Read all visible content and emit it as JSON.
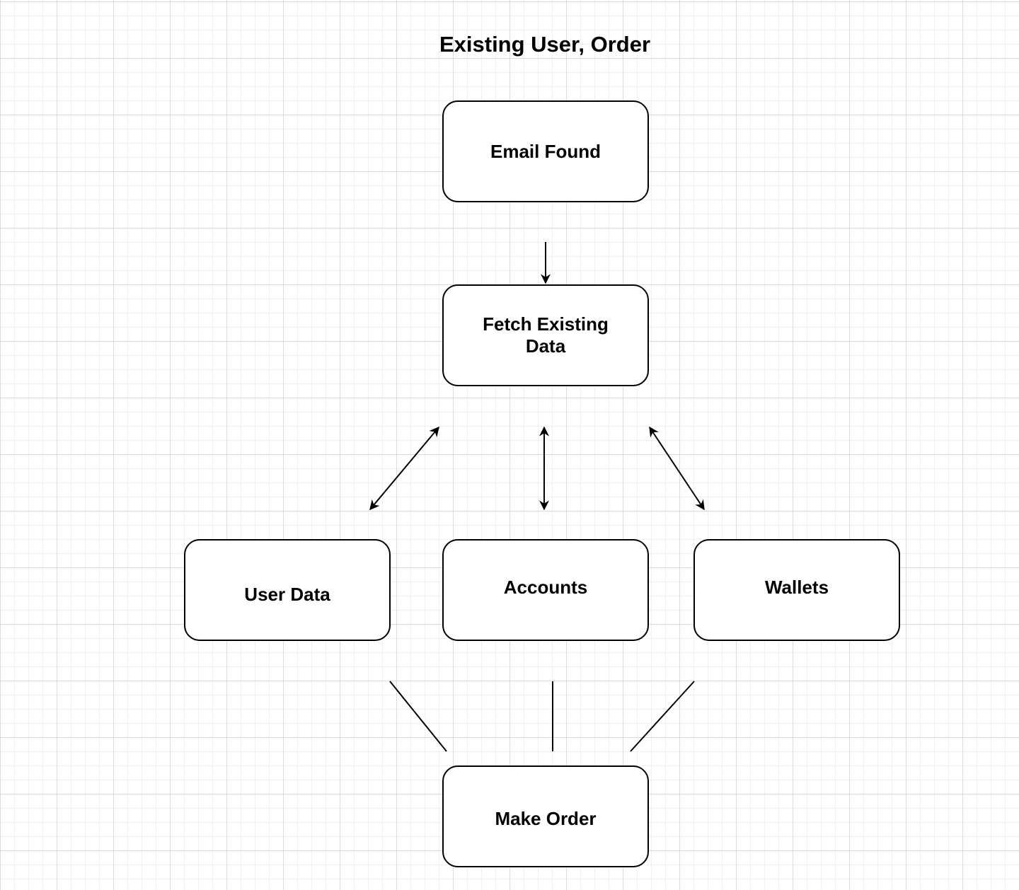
{
  "diagram": {
    "title": "Existing User, Order",
    "nodes": {
      "email_found": "Email Found",
      "fetch_existing_data": "Fetch Existing Data",
      "user_data": "User Data",
      "accounts": "Accounts",
      "wallets": "Wallets",
      "make_order": "Make Order"
    },
    "edges": [
      {
        "from": "Email Found",
        "to": "Fetch Existing Data",
        "arrow": "single"
      },
      {
        "from": "Fetch Existing Data",
        "to": "User Data",
        "arrow": "double"
      },
      {
        "from": "Fetch Existing Data",
        "to": "Accounts",
        "arrow": "double"
      },
      {
        "from": "Fetch Existing Data",
        "to": "Wallets",
        "arrow": "double"
      },
      {
        "from": "User Data",
        "to": "Make Order",
        "arrow": "none"
      },
      {
        "from": "Accounts",
        "to": "Make Order",
        "arrow": "none"
      },
      {
        "from": "Wallets",
        "to": "Make Order",
        "arrow": "none"
      }
    ],
    "colors": {
      "stroke": "#000000",
      "node_fill": "#ffffff",
      "grid": "#dcdcdc"
    }
  }
}
